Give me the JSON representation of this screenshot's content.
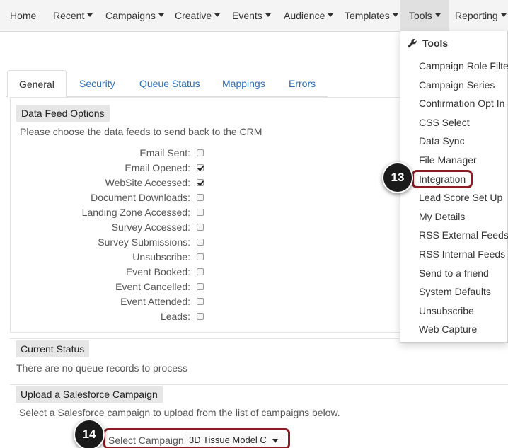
{
  "nav": {
    "items": [
      {
        "label": "Home",
        "caret": false
      },
      {
        "label": "Recent",
        "caret": true
      },
      {
        "label": "Campaigns",
        "caret": true
      },
      {
        "label": "Creative",
        "caret": true
      },
      {
        "label": "Events",
        "caret": true
      },
      {
        "label": "Audience",
        "caret": true
      },
      {
        "label": "Templates",
        "caret": true
      },
      {
        "label": "Tools",
        "caret": true
      },
      {
        "label": "Reporting",
        "caret": true
      }
    ],
    "active": "Tools"
  },
  "tabs": [
    {
      "label": "General",
      "active": true
    },
    {
      "label": "Security",
      "active": false
    },
    {
      "label": "Queue Status",
      "active": false
    },
    {
      "label": "Mappings",
      "active": false
    },
    {
      "label": "Errors",
      "active": false
    }
  ],
  "data_feed": {
    "title": "Data Feed Options",
    "help": "Please choose the data feeds to send back to the CRM",
    "options": [
      {
        "label": "Email Sent:",
        "checked": false
      },
      {
        "label": "Email Opened:",
        "checked": true
      },
      {
        "label": "WebSite Accessed:",
        "checked": true
      },
      {
        "label": "Document Downloads:",
        "checked": false
      },
      {
        "label": "Landing Zone Accessed:",
        "checked": false
      },
      {
        "label": "Survey Accessed:",
        "checked": false
      },
      {
        "label": "Survey Submissions:",
        "checked": false
      },
      {
        "label": "Unsubscribe:",
        "checked": false
      },
      {
        "label": "Event Booked:",
        "checked": false
      },
      {
        "label": "Event Cancelled:",
        "checked": false
      },
      {
        "label": "Event Attended:",
        "checked": false
      },
      {
        "label": "Leads:",
        "checked": false
      }
    ]
  },
  "current_status": {
    "title": "Current Status",
    "message": "There are no queue records to process"
  },
  "upload": {
    "title": "Upload a Salesforce Campaign",
    "help": "Select a Salesforce campaign to upload from the list of campaigns below.",
    "select_label": "Select Campaign:",
    "select_value": "3D Tissue Model C"
  },
  "tools_menu": {
    "header": "Tools",
    "icon": "wrench-icon",
    "items": [
      "Campaign Role Filter",
      "Campaign Series",
      "Confirmation Opt In",
      "CSS Select",
      "Data Sync",
      "File Manager",
      "Integration",
      "Lead Score Set Up",
      "My Details",
      "RSS External Feeds",
      "RSS Internal Feeds",
      "Send to a friend",
      "System Defaults",
      "Unsubscribe",
      "Web Capture"
    ],
    "highlighted": "Integration"
  },
  "callouts": {
    "step13": "13",
    "step14": "14",
    "highlight_color": "#8b1a22",
    "badge_color": "#1a1a1a"
  },
  "colors": {
    "link": "#2a6ebb",
    "nav_bg": "#f4f4f4",
    "section_bg": "#e6e6e6"
  }
}
